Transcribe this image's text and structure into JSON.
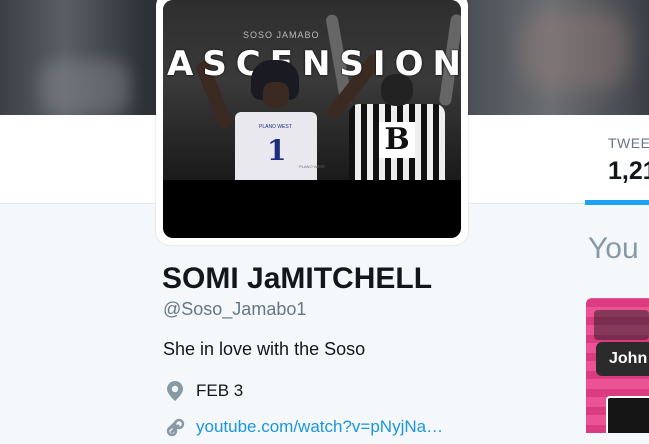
{
  "avatar": {
    "credit_text": "SOSO JAMABO",
    "title_text": "ASCENSION",
    "jersey_number": "1",
    "jersey_text": "PLANO WEST",
    "referee_letter": "B"
  },
  "stats": {
    "tweets_label": "TWEE",
    "tweets_count": "1,21",
    "accent_color": "#1da1f2"
  },
  "profile": {
    "name": "SOMI JaMITCHELL",
    "handle": "@Soso_Jamabo1",
    "bio": "She in love with the Soso",
    "location_icon": "location-pin-icon",
    "date": "FEB 3",
    "link_icon": "link-icon",
    "link_text": "youtube.com/watch?v=pNyjNa…",
    "link_color": "#1b95e0"
  },
  "sidebar": {
    "heading": "You",
    "card_label": "John"
  }
}
